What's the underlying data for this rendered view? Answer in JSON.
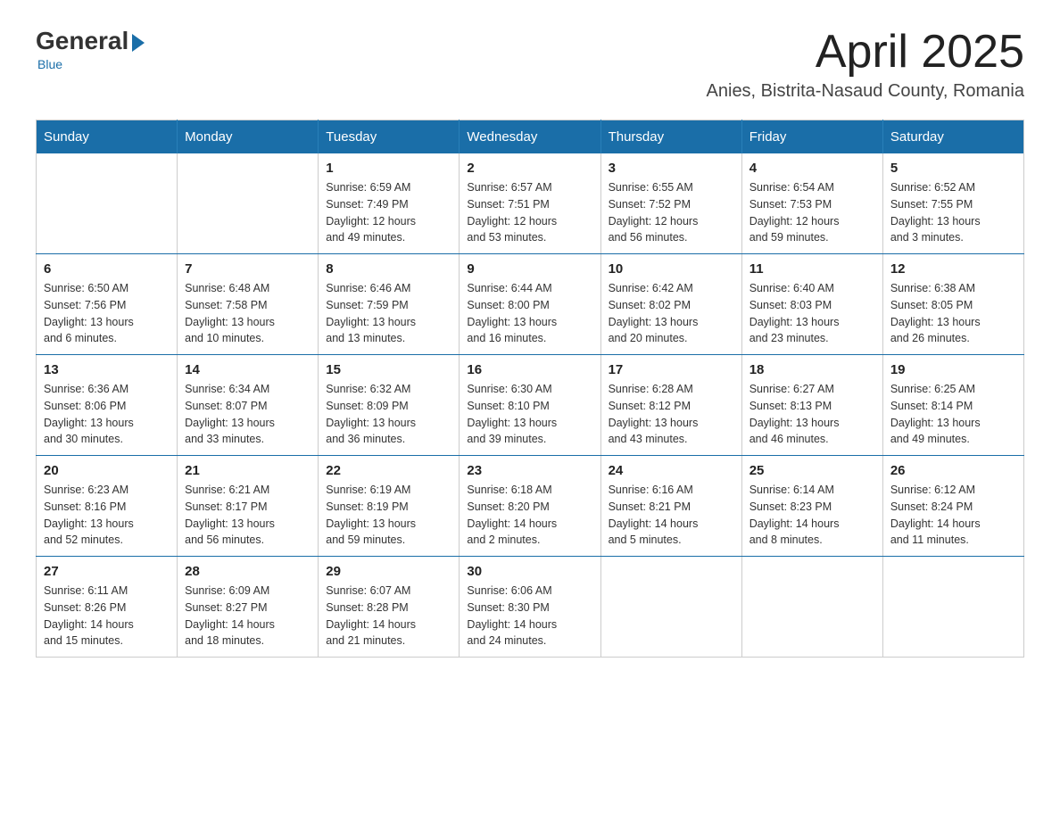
{
  "logo": {
    "general": "General",
    "blue": "Blue",
    "subtitle": "Blue"
  },
  "header": {
    "month": "April 2025",
    "location": "Anies, Bistrita-Nasaud County, Romania"
  },
  "weekdays": [
    "Sunday",
    "Monday",
    "Tuesday",
    "Wednesday",
    "Thursday",
    "Friday",
    "Saturday"
  ],
  "weeks": [
    [
      {
        "day": "",
        "info": ""
      },
      {
        "day": "",
        "info": ""
      },
      {
        "day": "1",
        "info": "Sunrise: 6:59 AM\nSunset: 7:49 PM\nDaylight: 12 hours\nand 49 minutes."
      },
      {
        "day": "2",
        "info": "Sunrise: 6:57 AM\nSunset: 7:51 PM\nDaylight: 12 hours\nand 53 minutes."
      },
      {
        "day": "3",
        "info": "Sunrise: 6:55 AM\nSunset: 7:52 PM\nDaylight: 12 hours\nand 56 minutes."
      },
      {
        "day": "4",
        "info": "Sunrise: 6:54 AM\nSunset: 7:53 PM\nDaylight: 12 hours\nand 59 minutes."
      },
      {
        "day": "5",
        "info": "Sunrise: 6:52 AM\nSunset: 7:55 PM\nDaylight: 13 hours\nand 3 minutes."
      }
    ],
    [
      {
        "day": "6",
        "info": "Sunrise: 6:50 AM\nSunset: 7:56 PM\nDaylight: 13 hours\nand 6 minutes."
      },
      {
        "day": "7",
        "info": "Sunrise: 6:48 AM\nSunset: 7:58 PM\nDaylight: 13 hours\nand 10 minutes."
      },
      {
        "day": "8",
        "info": "Sunrise: 6:46 AM\nSunset: 7:59 PM\nDaylight: 13 hours\nand 13 minutes."
      },
      {
        "day": "9",
        "info": "Sunrise: 6:44 AM\nSunset: 8:00 PM\nDaylight: 13 hours\nand 16 minutes."
      },
      {
        "day": "10",
        "info": "Sunrise: 6:42 AM\nSunset: 8:02 PM\nDaylight: 13 hours\nand 20 minutes."
      },
      {
        "day": "11",
        "info": "Sunrise: 6:40 AM\nSunset: 8:03 PM\nDaylight: 13 hours\nand 23 minutes."
      },
      {
        "day": "12",
        "info": "Sunrise: 6:38 AM\nSunset: 8:05 PM\nDaylight: 13 hours\nand 26 minutes."
      }
    ],
    [
      {
        "day": "13",
        "info": "Sunrise: 6:36 AM\nSunset: 8:06 PM\nDaylight: 13 hours\nand 30 minutes."
      },
      {
        "day": "14",
        "info": "Sunrise: 6:34 AM\nSunset: 8:07 PM\nDaylight: 13 hours\nand 33 minutes."
      },
      {
        "day": "15",
        "info": "Sunrise: 6:32 AM\nSunset: 8:09 PM\nDaylight: 13 hours\nand 36 minutes."
      },
      {
        "day": "16",
        "info": "Sunrise: 6:30 AM\nSunset: 8:10 PM\nDaylight: 13 hours\nand 39 minutes."
      },
      {
        "day": "17",
        "info": "Sunrise: 6:28 AM\nSunset: 8:12 PM\nDaylight: 13 hours\nand 43 minutes."
      },
      {
        "day": "18",
        "info": "Sunrise: 6:27 AM\nSunset: 8:13 PM\nDaylight: 13 hours\nand 46 minutes."
      },
      {
        "day": "19",
        "info": "Sunrise: 6:25 AM\nSunset: 8:14 PM\nDaylight: 13 hours\nand 49 minutes."
      }
    ],
    [
      {
        "day": "20",
        "info": "Sunrise: 6:23 AM\nSunset: 8:16 PM\nDaylight: 13 hours\nand 52 minutes."
      },
      {
        "day": "21",
        "info": "Sunrise: 6:21 AM\nSunset: 8:17 PM\nDaylight: 13 hours\nand 56 minutes."
      },
      {
        "day": "22",
        "info": "Sunrise: 6:19 AM\nSunset: 8:19 PM\nDaylight: 13 hours\nand 59 minutes."
      },
      {
        "day": "23",
        "info": "Sunrise: 6:18 AM\nSunset: 8:20 PM\nDaylight: 14 hours\nand 2 minutes."
      },
      {
        "day": "24",
        "info": "Sunrise: 6:16 AM\nSunset: 8:21 PM\nDaylight: 14 hours\nand 5 minutes."
      },
      {
        "day": "25",
        "info": "Sunrise: 6:14 AM\nSunset: 8:23 PM\nDaylight: 14 hours\nand 8 minutes."
      },
      {
        "day": "26",
        "info": "Sunrise: 6:12 AM\nSunset: 8:24 PM\nDaylight: 14 hours\nand 11 minutes."
      }
    ],
    [
      {
        "day": "27",
        "info": "Sunrise: 6:11 AM\nSunset: 8:26 PM\nDaylight: 14 hours\nand 15 minutes."
      },
      {
        "day": "28",
        "info": "Sunrise: 6:09 AM\nSunset: 8:27 PM\nDaylight: 14 hours\nand 18 minutes."
      },
      {
        "day": "29",
        "info": "Sunrise: 6:07 AM\nSunset: 8:28 PM\nDaylight: 14 hours\nand 21 minutes."
      },
      {
        "day": "30",
        "info": "Sunrise: 6:06 AM\nSunset: 8:30 PM\nDaylight: 14 hours\nand 24 minutes."
      },
      {
        "day": "",
        "info": ""
      },
      {
        "day": "",
        "info": ""
      },
      {
        "day": "",
        "info": ""
      }
    ]
  ]
}
